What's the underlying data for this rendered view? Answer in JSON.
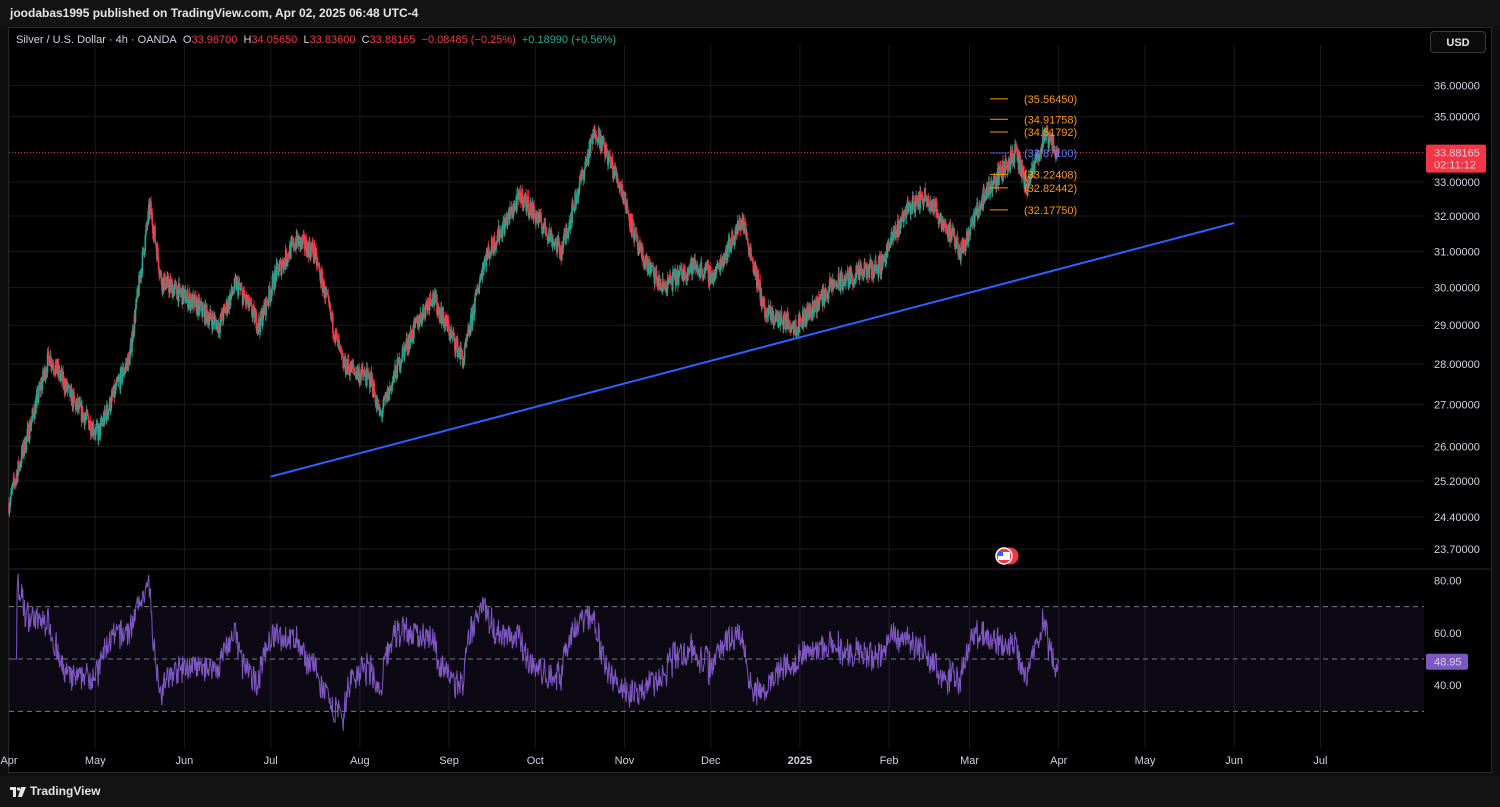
{
  "header": {
    "publisher": "joodabas1995 published on TradingView.com, Apr 02, 2025 06:48 UTC-4"
  },
  "legend": {
    "symbol": "Silver / U.S. Dollar · 4h · OANDA",
    "o_label": "O",
    "o": "33.96700",
    "h_label": "H",
    "h": "34.05650",
    "l_label": "L",
    "l": "33.83600",
    "c_label": "C",
    "c": "33.88165",
    "change": "−0.08485 (−0.25%)",
    "change2": "+0.18990 (+0.56%)"
  },
  "currency_button": "USD",
  "footer": {
    "brand": "TradingView"
  },
  "colors": {
    "up": "#22ab94",
    "down": "#f23645",
    "trendline": "#2962ff",
    "level": "#ff9800",
    "rsi": "#7e57c2",
    "bg": "#000000"
  },
  "chart_data": [
    {
      "type": "candlestick",
      "title": "Silver / U.S. Dollar · 4h · OANDA",
      "x_ticks": [
        "Apr",
        "May",
        "Jun",
        "Jul",
        "Aug",
        "Sep",
        "Oct",
        "Nov",
        "Dec",
        "2025",
        "Feb",
        "Mar",
        "Apr",
        "May",
        "Jun",
        "Jul"
      ],
      "y_ticks": [
        "36.00000",
        "35.00000",
        "33.00000",
        "32.00000",
        "31.00000",
        "30.00000",
        "29.00000",
        "28.00000",
        "27.00000",
        "26.00000",
        "25.20000",
        "24.40000",
        "23.70000"
      ],
      "y_scale": "log",
      "ylim": [
        23.3,
        37.0
      ],
      "price_path": [
        {
          "date": "2024-04-01",
          "price": 24.7
        },
        {
          "date": "2024-04-08",
          "price": 26.4
        },
        {
          "date": "2024-04-15",
          "price": 28.2
        },
        {
          "date": "2024-04-24",
          "price": 27.0
        },
        {
          "date": "2024-05-02",
          "price": 26.3
        },
        {
          "date": "2024-05-13",
          "price": 28.2
        },
        {
          "date": "2024-05-20",
          "price": 32.3
        },
        {
          "date": "2024-05-24",
          "price": 30.2
        },
        {
          "date": "2024-06-04",
          "price": 29.6
        },
        {
          "date": "2024-06-13",
          "price": 29.0
        },
        {
          "date": "2024-06-19",
          "price": 30.1
        },
        {
          "date": "2024-06-27",
          "price": 29.0
        },
        {
          "date": "2024-07-03",
          "price": 30.4
        },
        {
          "date": "2024-07-10",
          "price": 31.3
        },
        {
          "date": "2024-07-16",
          "price": 31.0
        },
        {
          "date": "2024-07-26",
          "price": 28.0
        },
        {
          "date": "2024-08-05",
          "price": 27.6
        },
        {
          "date": "2024-08-08",
          "price": 26.7
        },
        {
          "date": "2024-08-16",
          "price": 28.3
        },
        {
          "date": "2024-08-26",
          "price": 29.8
        },
        {
          "date": "2024-09-06",
          "price": 28.1
        },
        {
          "date": "2024-09-13",
          "price": 30.7
        },
        {
          "date": "2024-09-26",
          "price": 32.6
        },
        {
          "date": "2024-10-10",
          "price": 31.0
        },
        {
          "date": "2024-10-22",
          "price": 34.6
        },
        {
          "date": "2024-10-31",
          "price": 32.8
        },
        {
          "date": "2024-11-06",
          "price": 31.0
        },
        {
          "date": "2024-11-14",
          "price": 30.0
        },
        {
          "date": "2024-11-25",
          "price": 30.6
        },
        {
          "date": "2024-12-02",
          "price": 30.3
        },
        {
          "date": "2024-12-12",
          "price": 31.9
        },
        {
          "date": "2024-12-20",
          "price": 29.3
        },
        {
          "date": "2024-12-31",
          "price": 29.0
        },
        {
          "date": "2025-01-13",
          "price": 30.1
        },
        {
          "date": "2025-01-29",
          "price": 30.6
        },
        {
          "date": "2025-02-07",
          "price": 32.2
        },
        {
          "date": "2025-02-14",
          "price": 32.6
        },
        {
          "date": "2025-02-26",
          "price": 31.0
        },
        {
          "date": "2025-03-06",
          "price": 32.6
        },
        {
          "date": "2025-03-17",
          "price": 33.9
        },
        {
          "date": "2025-03-21",
          "price": 32.8
        },
        {
          "date": "2025-03-27",
          "price": 34.4
        },
        {
          "date": "2025-04-01",
          "price": 33.9
        }
      ],
      "last_price": "33.88165",
      "countdown": "02:11:12",
      "trendline": [
        {
          "date": "2024-07-01",
          "price": 25.3
        },
        {
          "date": "2025-06-01",
          "price": 31.8
        }
      ],
      "levels": [
        {
          "label": "(35.56450)",
          "price": 35.5645
        },
        {
          "label": "(34.91758)",
          "price": 34.91758
        },
        {
          "label": "(34.51792)",
          "price": 34.51792
        },
        {
          "label": "(33.87100)",
          "price": 33.871
        },
        {
          "label": "(33.22408)",
          "price": 33.22408
        },
        {
          "label": "(32.82442)",
          "price": 32.82442
        },
        {
          "label": "(32.17750)",
          "price": 32.1775
        }
      ],
      "grid": true
    },
    {
      "type": "line",
      "y_ticks": [
        "80.00",
        "60.00",
        "40.00"
      ],
      "ylim": [
        16,
        84
      ],
      "bands": [
        70,
        50,
        30
      ],
      "last_value": "48.95"
    }
  ]
}
